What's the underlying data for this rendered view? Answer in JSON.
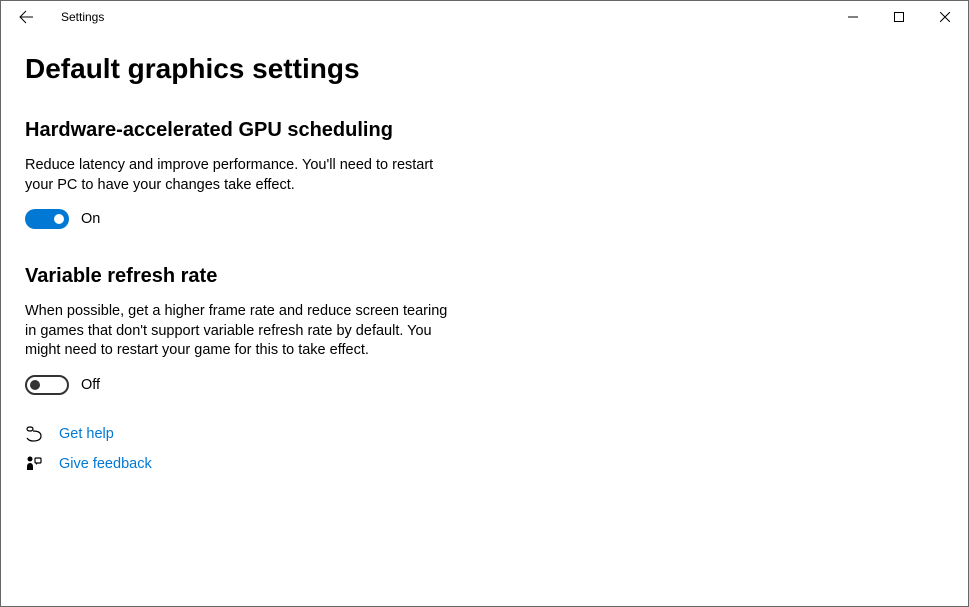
{
  "window": {
    "app_title": "Settings"
  },
  "page": {
    "title": "Default graphics settings"
  },
  "sections": {
    "gpu": {
      "heading": "Hardware-accelerated GPU scheduling",
      "description": "Reduce latency and improve performance. You'll need to restart your PC to have your changes take effect.",
      "toggle_state": "On"
    },
    "vrr": {
      "heading": "Variable refresh rate",
      "description": "When possible, get a higher frame rate and reduce screen tearing in games that don't support variable refresh rate by default. You might need to restart your game for this to take effect.",
      "toggle_state": "Off"
    }
  },
  "links": {
    "help": "Get help",
    "feedback": "Give feedback"
  }
}
